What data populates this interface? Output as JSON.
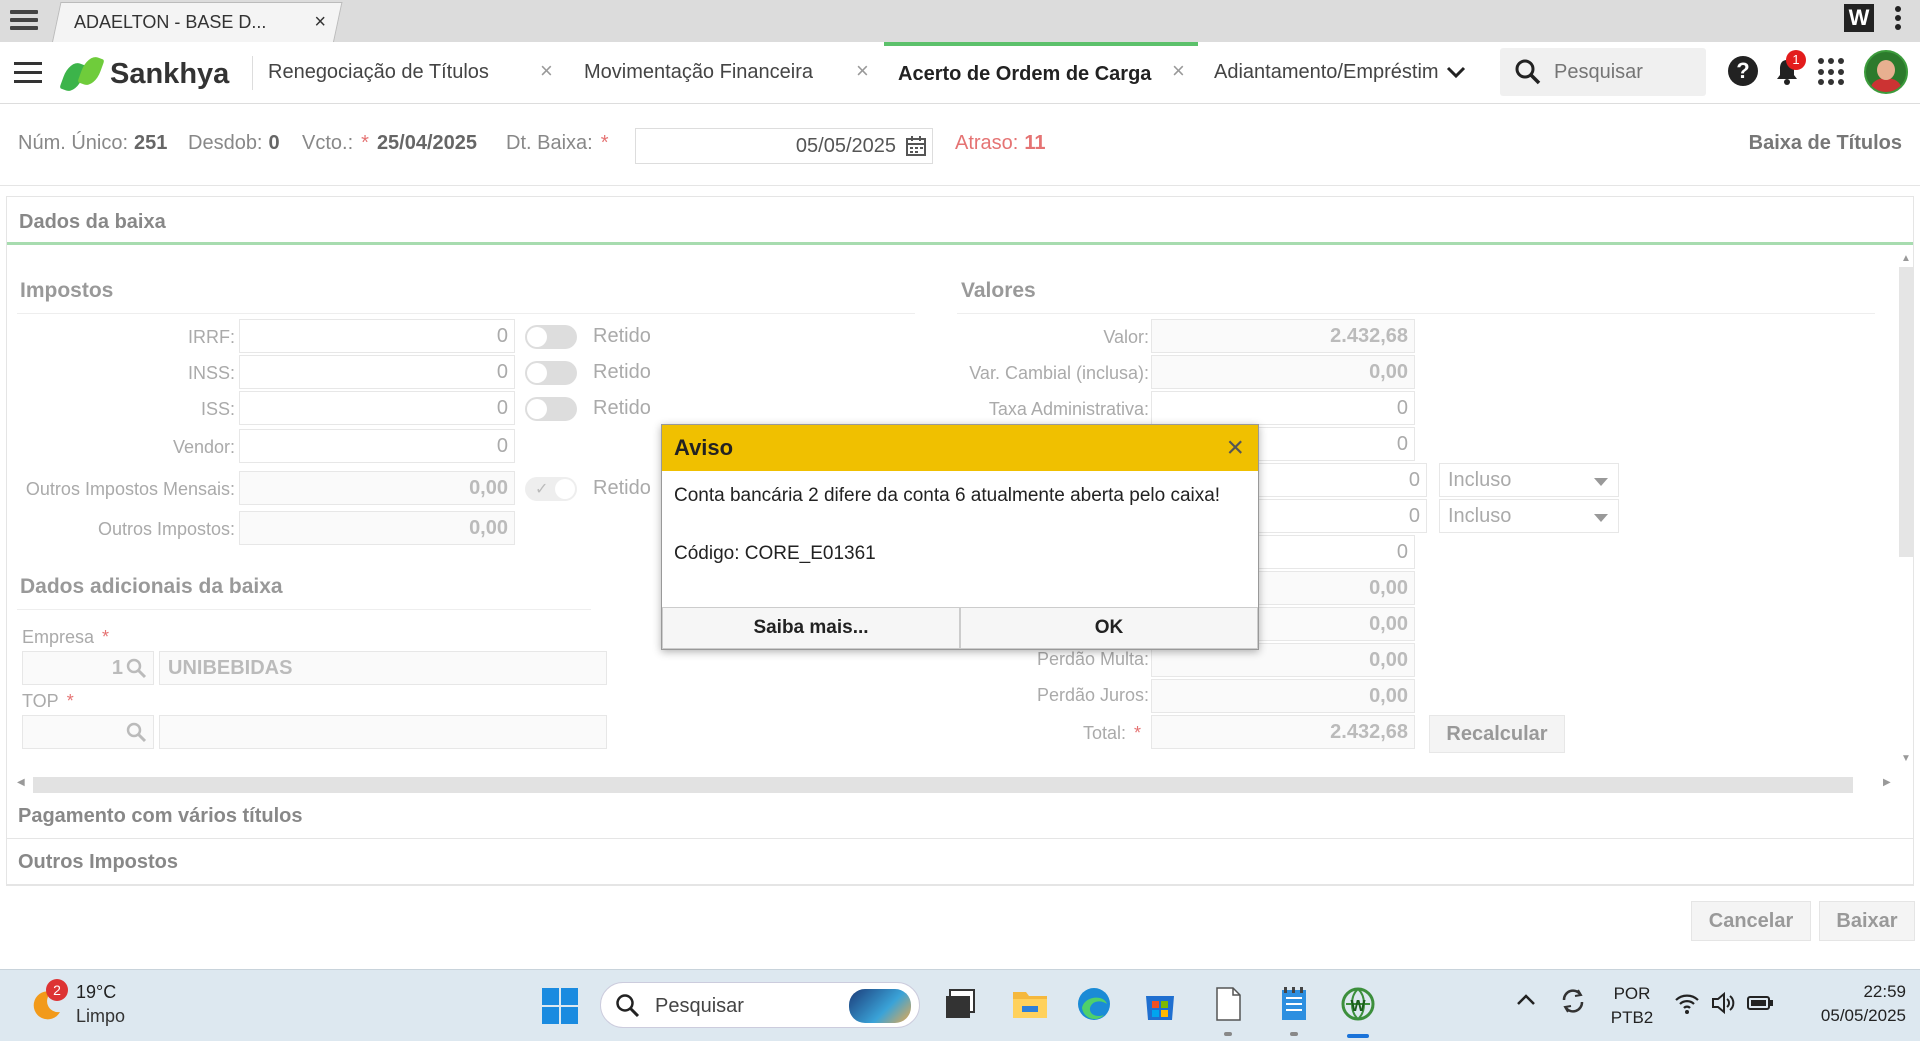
{
  "browser": {
    "tab_title": "ADAELTON - BASE D...",
    "tab_close": "×"
  },
  "app": {
    "logo_text": "Sankhya",
    "tabs": [
      {
        "label": "Renegociação de Títulos",
        "close": "×"
      },
      {
        "label": "Movimentação Financeira",
        "close": "×"
      },
      {
        "label": "Acerto de Ordem de Carga",
        "close": "×"
      },
      {
        "label": "Adiantamento/Empréstim"
      }
    ],
    "search_placeholder": "Pesquisar",
    "help": "?",
    "notifications_count": "1",
    "brand_color": "#5cc16b"
  },
  "info": {
    "num_unico_label": "Núm. Único:",
    "num_unico": "251",
    "desdob_label": "Desdob:",
    "desdob": "0",
    "vcto_label": "Vcto.:",
    "vcto": "25/04/2025",
    "dt_baixa_label": "Dt. Baixa:",
    "dt_baixa": "05/05/2025",
    "atraso_label": "Atraso:",
    "atraso": "11",
    "page_title": "Baixa de Títulos",
    "required_mark": "*"
  },
  "dados_baixa": {
    "title": "Dados da baixa",
    "impostos": {
      "title": "Impostos",
      "rows": [
        {
          "label": "IRRF:",
          "value": "0",
          "toggle_label": "Retido"
        },
        {
          "label": "INSS:",
          "value": "0",
          "toggle_label": "Retido"
        },
        {
          "label": "ISS:",
          "value": "0",
          "toggle_label": "Retido"
        },
        {
          "label": "Vendor:",
          "value": "0"
        },
        {
          "label": "Outros Impostos Mensais:",
          "value": "0,00",
          "toggle_label": "Retido"
        },
        {
          "label": "Outros Impostos:",
          "value": "0,00"
        }
      ]
    },
    "adicionais": {
      "title": "Dados adicionais da baixa",
      "empresa_label": "Empresa",
      "empresa_code": "1",
      "empresa_name": "UNIBEBIDAS",
      "top_label": "TOP"
    },
    "valores": {
      "title": "Valores",
      "valor_label": "Valor:",
      "valor": "2.432,68",
      "var_cambial_label": "Var. Cambial (inclusa):",
      "var_cambial": "0,00",
      "taxa_adm_label": "Taxa Administrativa:",
      "taxa_adm": "0",
      "hidden_values": [
        "0",
        "0",
        "0",
        "0",
        "0,00",
        "0,00"
      ],
      "incluso_options": [
        "Incluso",
        "Incluso"
      ],
      "perdao_multa_label": "Perdão Multa:",
      "perdao_multa": "0,00",
      "perdao_juros_label": "Perdão Juros:",
      "perdao_juros": "0,00",
      "total_label": "Total:",
      "total": "2.432,68",
      "recalcular": "Recalcular"
    }
  },
  "sections": {
    "pagamento": "Pagamento com vários títulos",
    "outros_impostos": "Outros Impostos"
  },
  "footer": {
    "cancelar": "Cancelar",
    "baixar": "Baixar"
  },
  "dialog": {
    "title": "Aviso",
    "close": "×",
    "message": "Conta bancária 2 difere da conta 6 atualmente aberta pelo caixa!",
    "code": "Código: CORE_E01361",
    "saiba_mais": "Saiba mais...",
    "ok": "OK",
    "header_color": "#f0c000"
  },
  "taskbar": {
    "weather_badge": "2",
    "temperature": "19°C",
    "weather": "Limpo",
    "search": "Pesquisar",
    "lang_top": "POR",
    "lang_bottom": "PTB2",
    "time": "22:59",
    "date": "05/05/2025"
  }
}
